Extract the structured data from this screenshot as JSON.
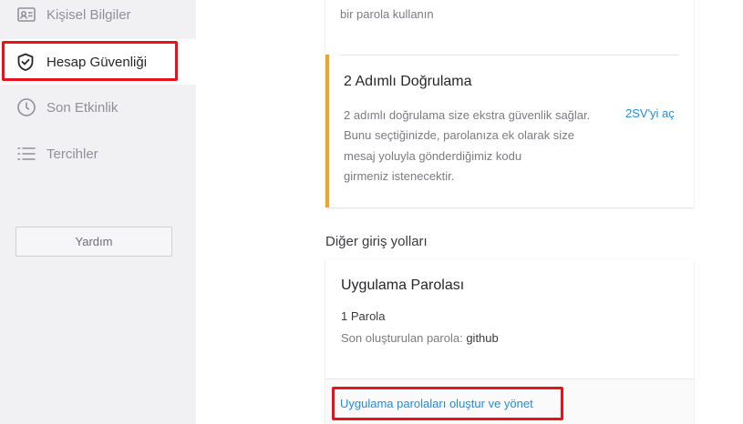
{
  "sidebar": {
    "items": [
      {
        "label": "Kişisel Bilgiler",
        "icon": "contact-card-icon",
        "active": false
      },
      {
        "label": "Hesap Güvenliği",
        "icon": "shield-check-icon",
        "active": true
      },
      {
        "label": "Son Etkinlik",
        "icon": "clock-icon",
        "active": false
      },
      {
        "label": "Tercihler",
        "icon": "list-icon",
        "active": false
      }
    ],
    "help_label": "Yardım"
  },
  "security": {
    "prev_item_desc": "bir parola kullanın",
    "two_step": {
      "title": "2 Adımlı Doğrulama",
      "desc_lines": [
        "2 adımlı doğrulama size ekstra güvenlik sağlar.",
        "Bunu seçtiğinizde, parolanıza ek olarak size",
        "mesaj yoluyla gönderdiğimiz kodu",
        "girmeniz istenecektir."
      ],
      "action_label": "2SV'yi aç"
    }
  },
  "other_signin": {
    "section_title": "Diğer giriş yolları",
    "app_passwords": {
      "title": "Uygulama Parolası",
      "count_text": "1 Parola",
      "last_created_label": "Son oluşturulan parola:",
      "last_created_value": "github",
      "manage_link": "Uygulama parolaları oluştur ve yönet"
    }
  },
  "colors": {
    "highlight": "#e8121a",
    "accent_warning": "#f3a521",
    "link": "#1f8de3",
    "sidebar_bg": "#f1f1f4"
  }
}
